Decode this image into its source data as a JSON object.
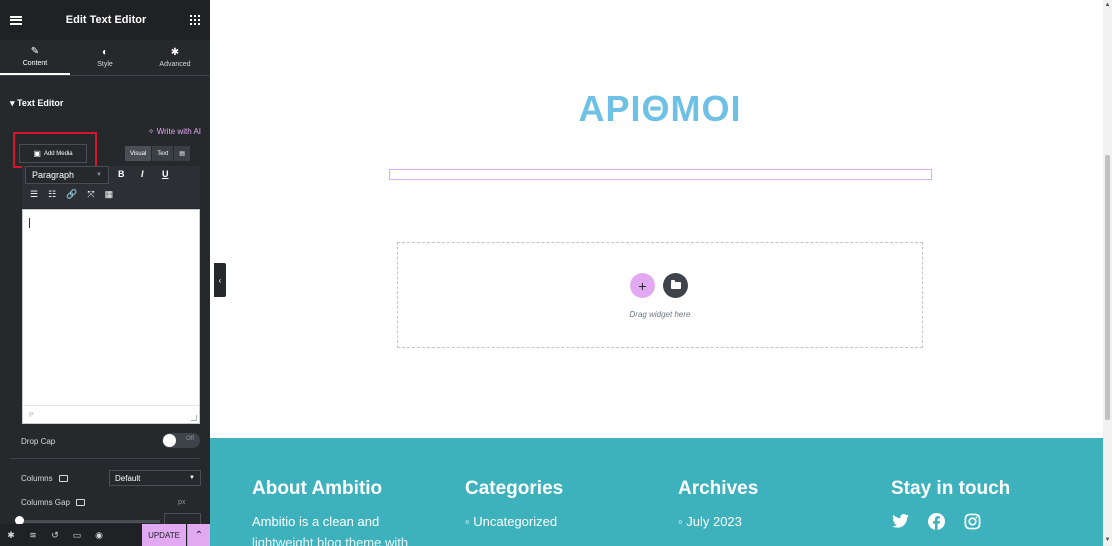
{
  "panel": {
    "header_title": "Edit Text Editor",
    "tabs": [
      {
        "label": "Content",
        "icon": "pencil-icon"
      },
      {
        "label": "Style",
        "icon": "contrast-icon"
      },
      {
        "label": "Advanced",
        "icon": "gear-icon"
      }
    ],
    "section_title": "▾ Text Editor",
    "write_ai": "✧ Write with AI",
    "add_media": "Add Media",
    "editor_tabs": [
      "Visual",
      "Text"
    ],
    "format_select": "Paragraph",
    "toolbar_row1": [
      "B",
      "I",
      "U"
    ],
    "text_path": "P",
    "drop_cap_label": "Drop Cap",
    "drop_cap_state": "Off",
    "columns_label": "Columns",
    "columns_value": "Default",
    "columns_gap_label": "Columns Gap",
    "columns_gap_unit": "px",
    "update_label": "UPDATE"
  },
  "preview": {
    "heading": "ΑΡΙΘΜΟΙ",
    "drag_hint": "Drag widget here"
  },
  "footer": {
    "about_title": "About Ambitio",
    "about_text": "Ambitio is a clean and",
    "about_text2": "lightweight blog theme with",
    "categories_title": "Categories",
    "categories_item": "Uncategorized",
    "archives_title": "Archives",
    "archives_item": "July 2023",
    "stay_title": "Stay in touch",
    "social": [
      "twitter-icon",
      "facebook-icon",
      "instagram-icon"
    ]
  },
  "colors": {
    "accent_pink": "#e2a9f3",
    "heading_blue": "#6ec1e4",
    "footer_teal": "#3db2bd",
    "highlight_red": "#d6152a"
  }
}
